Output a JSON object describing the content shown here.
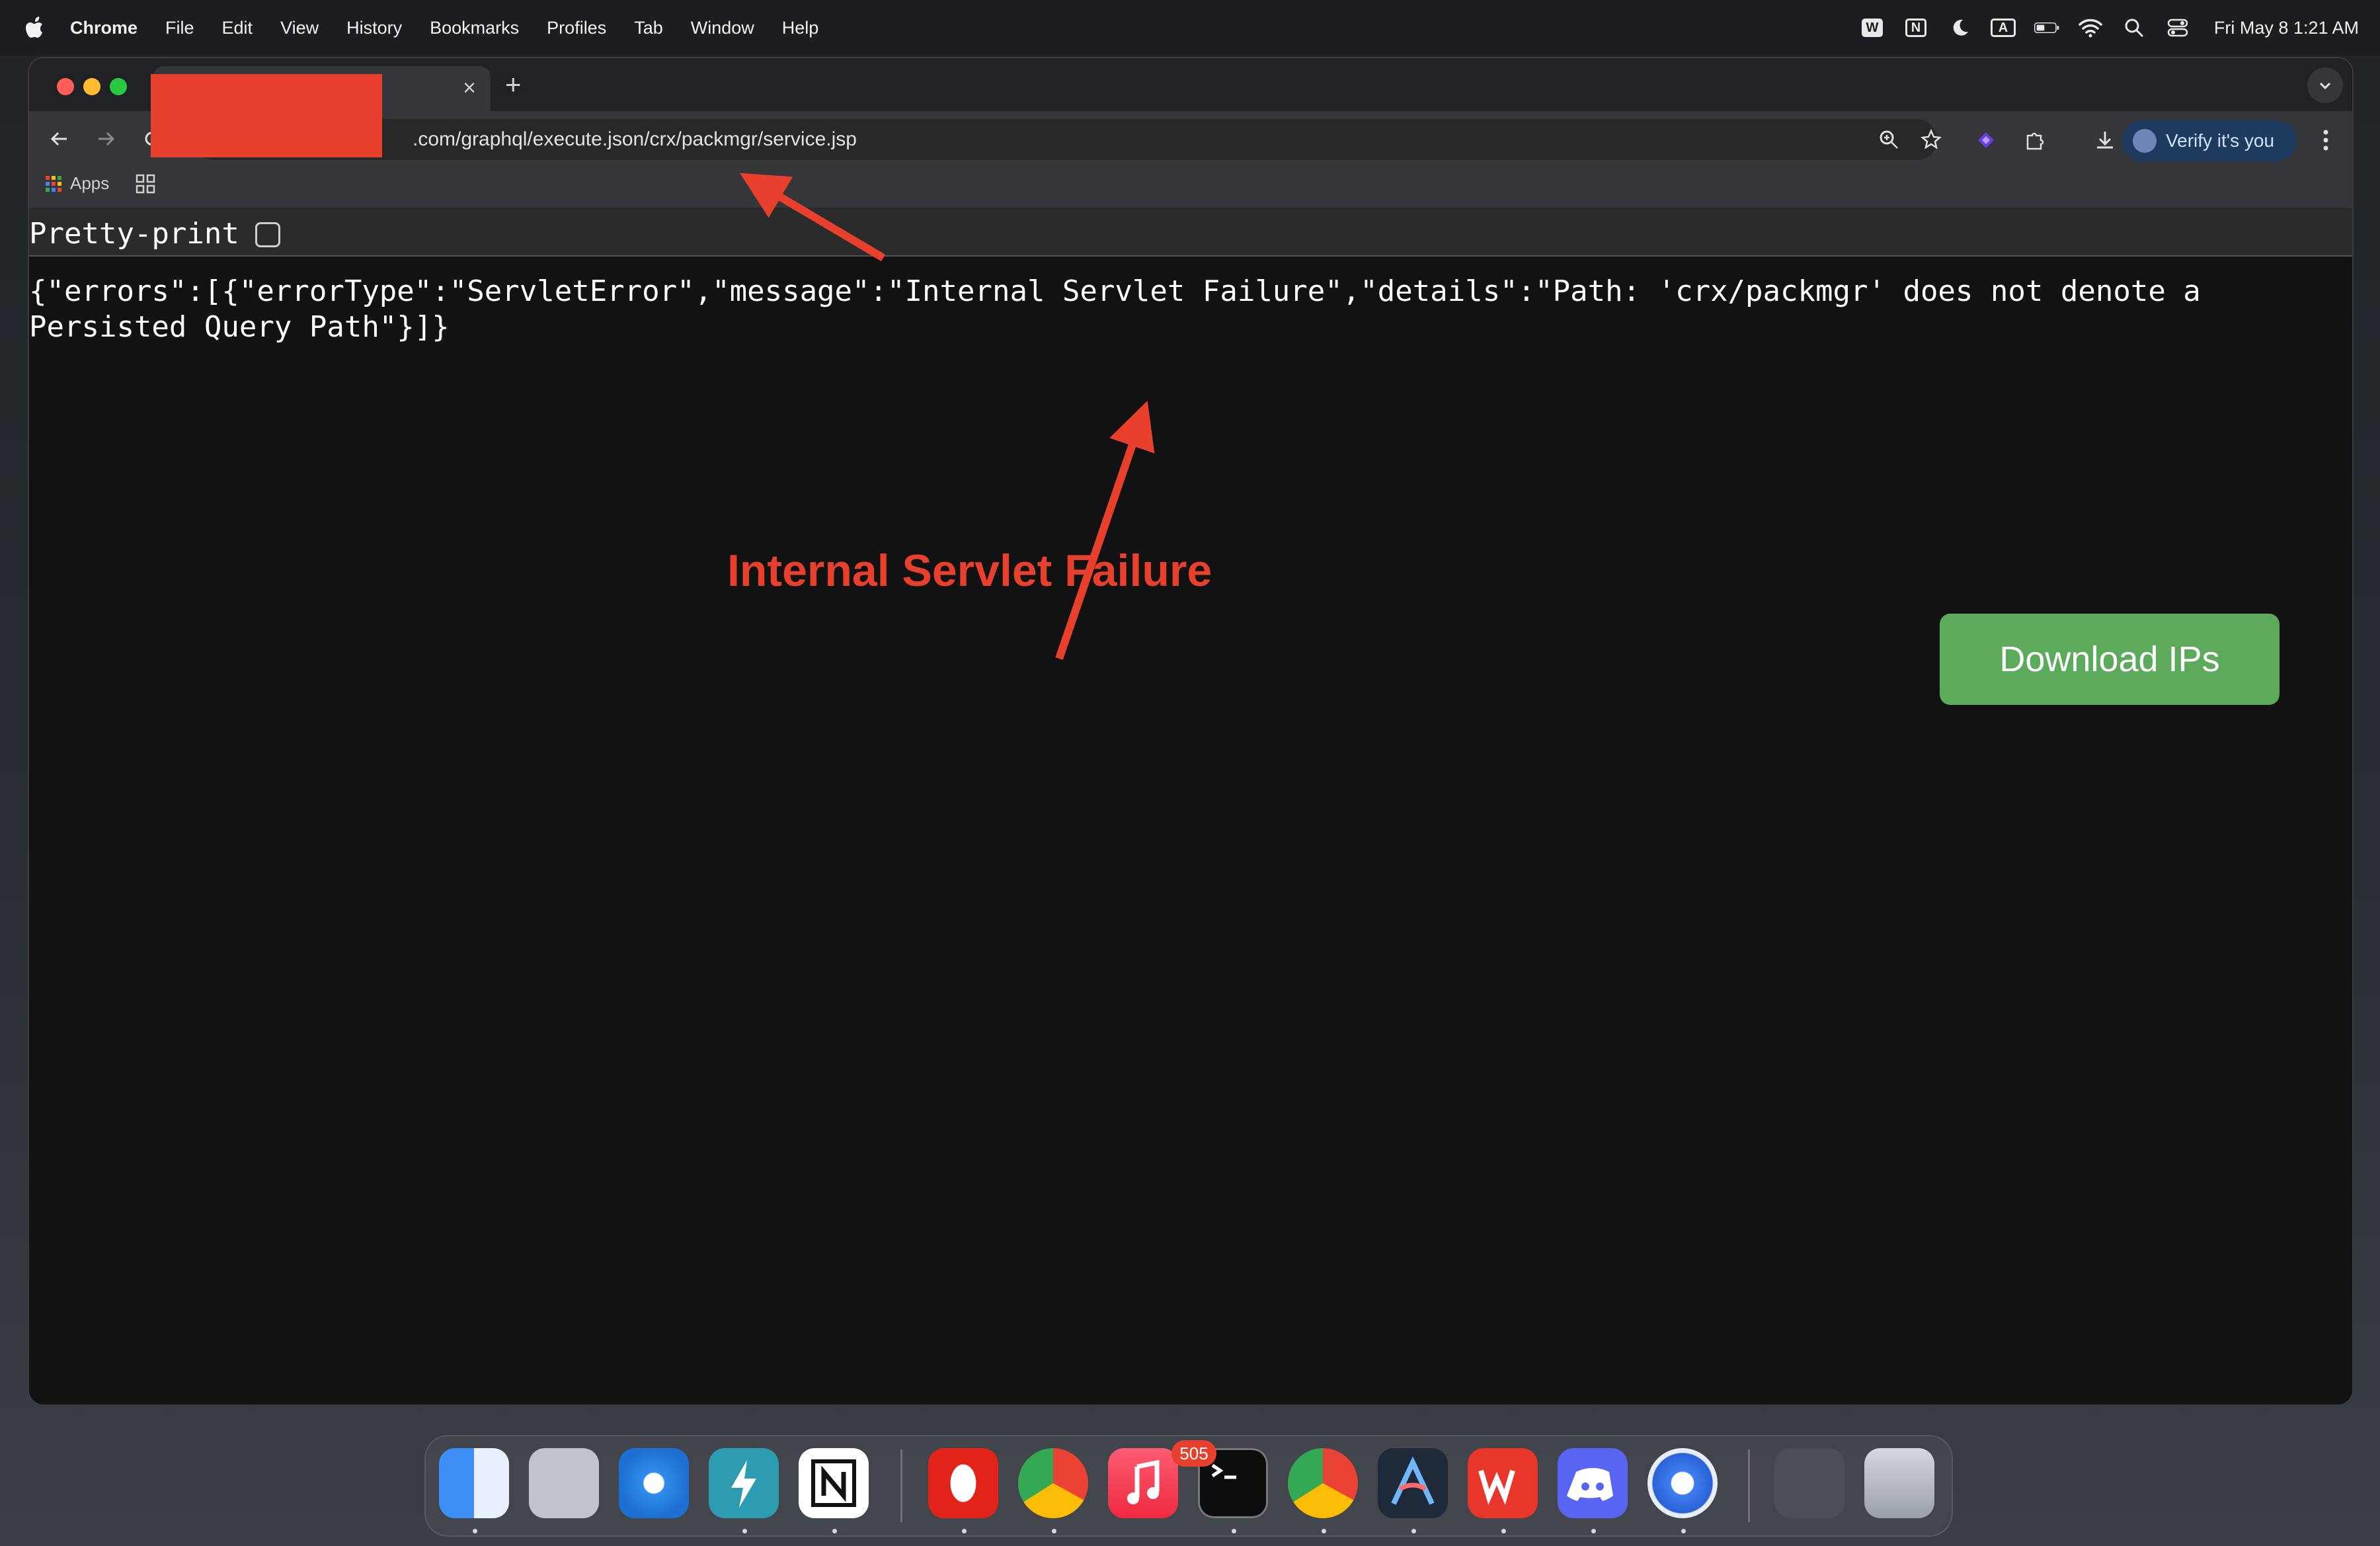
{
  "menubar": {
    "app_name": "Chrome",
    "items": [
      "File",
      "Edit",
      "View",
      "History",
      "Bookmarks",
      "Profiles",
      "Tab",
      "Window",
      "Help"
    ],
    "status_letters": {
      "w": "W",
      "n": "N",
      "a": "A"
    },
    "clock": "Fri May 8  1:21 AM"
  },
  "browser": {
    "tab": {
      "close_glyph": "×"
    },
    "new_tab_glyph": "+",
    "url": ".com/graphql/execute.json/crx/packmgr/service.jsp",
    "profile_button": "Verify it's you",
    "bookmarks": {
      "apps_label": "Apps"
    }
  },
  "page": {
    "pretty_print_label": "Pretty-print",
    "pretty_print_checked": false,
    "json_text": "{\"errors\":[{\"errorType\":\"ServletError\",\"message\":\"Internal Servlet Failure\",\"details\":\"Path: 'crx/packmgr' does not denote a Persisted Query Path\"}]}",
    "annotation": "Internal Servlet Failure",
    "download_button": "Download IPs"
  },
  "dock": {
    "apps": [
      "finder-icon",
      "launchpad-icon",
      "safari-icon",
      "bolt-app-icon",
      "notion-icon",
      "opera-icon",
      "chrome-icon",
      "music-icon",
      "terminal-icon",
      "chrome-icon",
      "arc-icon",
      "wps-icon",
      "discord-icon",
      "chromium-icon",
      "window-preview-icon",
      "trash-icon"
    ],
    "discord_badge": "505"
  },
  "colors": {
    "annotation_red": "#e8402c",
    "download_green": "#5caa5b",
    "page_background": "#121212"
  }
}
